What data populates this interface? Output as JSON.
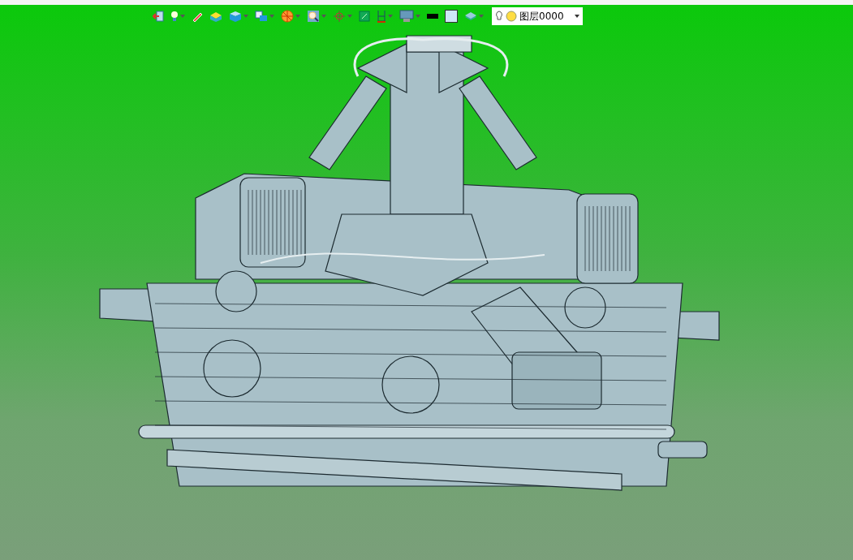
{
  "toolbar": {
    "tools": [
      {
        "kind": "exit",
        "menu": false
      },
      {
        "kind": "bulb",
        "menu": true
      },
      {
        "kind": "pencil",
        "menu": false
      },
      {
        "kind": "box-open",
        "menu": false
      },
      {
        "kind": "cube",
        "menu": true
      },
      {
        "kind": "view",
        "menu": true
      },
      {
        "kind": "section",
        "menu": true
      },
      {
        "kind": "zoom",
        "menu": true
      },
      {
        "kind": "axis",
        "menu": true
      },
      {
        "kind": "fit",
        "menu": false
      },
      {
        "kind": "ruler",
        "menu": true
      },
      {
        "kind": "monitor",
        "menu": true
      },
      {
        "kind": "line",
        "menu": false
      },
      {
        "kind": "square",
        "menu": false
      },
      {
        "kind": "layers",
        "menu": true
      }
    ],
    "layer_select": {
      "value": "图层0000"
    }
  }
}
